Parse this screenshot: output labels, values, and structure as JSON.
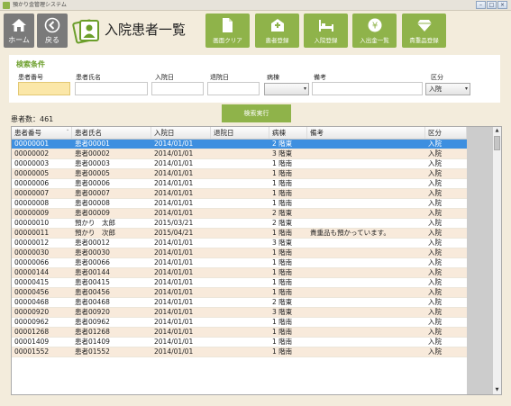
{
  "window": {
    "title": "預かり金管理システム",
    "buttons": [
      "–",
      "□",
      "×"
    ]
  },
  "nav": {
    "home_label": "ホーム",
    "back_label": "戻る"
  },
  "page_title": "入院患者一覧",
  "actions": [
    {
      "label": "画面クリア",
      "icon": "file-icon"
    },
    {
      "label": "患者登録",
      "icon": "hospital-icon"
    },
    {
      "label": "入院登録",
      "icon": "bed-icon"
    },
    {
      "label": "入出金一覧",
      "icon": "yen-icon"
    },
    {
      "label": "貴重品登録",
      "icon": "diamond-icon"
    }
  ],
  "search": {
    "title": "検索条件",
    "labels": {
      "patient_no": "患者番号",
      "patient_name": "患者氏名",
      "admit_date": "入院日",
      "discharge_date": "退院日",
      "ward": "病棟",
      "note": "備考",
      "category": "区分"
    },
    "values": {
      "patient_no": "",
      "patient_name": "",
      "admit_date": "",
      "discharge_date": "",
      "ward": "",
      "note": ""
    },
    "category_selected": "入院",
    "exec_label": "検索実行"
  },
  "count_label": "患者数：461",
  "table": {
    "columns": [
      "患者番号",
      "患者氏名",
      "入院日",
      "退院日",
      "病棟",
      "備考",
      "区分"
    ],
    "rows": [
      [
        "00000001",
        "患者00001",
        "2014/01/01",
        "",
        "2 階東",
        "",
        "入院"
      ],
      [
        "00000002",
        "患者00002",
        "2014/01/01",
        "",
        "3 階東",
        "",
        "入院"
      ],
      [
        "00000003",
        "患者00003",
        "2014/01/01",
        "",
        "1 階南",
        "",
        "入院"
      ],
      [
        "00000005",
        "患者00005",
        "2014/01/01",
        "",
        "1 階南",
        "",
        "入院"
      ],
      [
        "00000006",
        "患者00006",
        "2014/01/01",
        "",
        "1 階南",
        "",
        "入院"
      ],
      [
        "00000007",
        "患者00007",
        "2014/01/01",
        "",
        "1 階南",
        "",
        "入院"
      ],
      [
        "00000008",
        "患者00008",
        "2014/01/01",
        "",
        "1 階南",
        "",
        "入院"
      ],
      [
        "00000009",
        "患者00009",
        "2014/01/01",
        "",
        "2 階東",
        "",
        "入院"
      ],
      [
        "00000010",
        "預かり　太郎",
        "2015/03/21",
        "",
        "2 階東",
        "",
        "入院"
      ],
      [
        "00000011",
        "預かり　次郎",
        "2015/04/21",
        "",
        "1 階南",
        "貴重品も預かっています。",
        "入院"
      ],
      [
        "00000012",
        "患者00012",
        "2014/01/01",
        "",
        "3 階東",
        "",
        "入院"
      ],
      [
        "00000030",
        "患者00030",
        "2014/01/01",
        "",
        "1 階南",
        "",
        "入院"
      ],
      [
        "00000066",
        "患者00066",
        "2014/01/01",
        "",
        "1 階南",
        "",
        "入院"
      ],
      [
        "00000144",
        "患者00144",
        "2014/01/01",
        "",
        "1 階南",
        "",
        "入院"
      ],
      [
        "00000415",
        "患者00415",
        "2014/01/01",
        "",
        "1 階南",
        "",
        "入院"
      ],
      [
        "00000456",
        "患者00456",
        "2014/01/01",
        "",
        "1 階南",
        "",
        "入院"
      ],
      [
        "00000468",
        "患者00468",
        "2014/01/01",
        "",
        "2 階東",
        "",
        "入院"
      ],
      [
        "00000920",
        "患者00920",
        "2014/01/01",
        "",
        "3 階東",
        "",
        "入院"
      ],
      [
        "00000962",
        "患者00962",
        "2014/01/01",
        "",
        "1 階南",
        "",
        "入院"
      ],
      [
        "00001268",
        "患者01268",
        "2014/01/01",
        "",
        "1 階南",
        "",
        "入院"
      ],
      [
        "00001409",
        "患者01409",
        "2014/01/01",
        "",
        "1 階南",
        "",
        "入院"
      ],
      [
        "00001552",
        "患者01552",
        "2014/01/01",
        "",
        "1 階南",
        "",
        "入院"
      ]
    ]
  },
  "colors": {
    "accent": "#8fb34a",
    "selected_row": "#3d8fe0",
    "alt_row": "#f8eadb",
    "background": "#f3ecdc"
  }
}
